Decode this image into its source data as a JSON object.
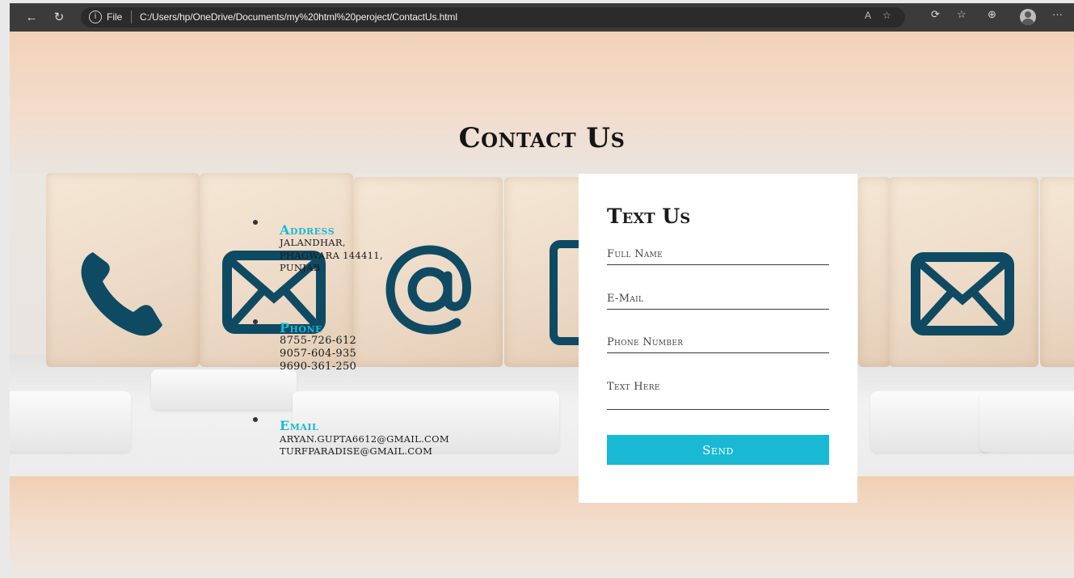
{
  "browser": {
    "file_label": "File",
    "url": "C:/Users/hp/OneDrive/Documents/my%20html%20peroject/ContactUs.html"
  },
  "page": {
    "title": "Contact Us"
  },
  "contact": {
    "address": {
      "heading": "Address",
      "lines": [
        "Jalandhar,",
        "Phagwara 144411,",
        "Punjab"
      ]
    },
    "phone": {
      "heading": "Phone",
      "lines": [
        "8755-726-612",
        "9057-604-935",
        "9690-361-250"
      ]
    },
    "email": {
      "heading": "Email",
      "lines": [
        "aryan.gupta6612@gmail.com",
        "turfparadise@gmail.com"
      ]
    }
  },
  "form": {
    "title": "Text Us",
    "full_name_placeholder": "Full Name",
    "email_placeholder": "E-Mail",
    "phone_placeholder": "Phone Number",
    "text_placeholder": "Text Here",
    "send_label": "Send"
  },
  "colors": {
    "accent": "#19b9d4",
    "icon_navy": "#0f4a63"
  }
}
